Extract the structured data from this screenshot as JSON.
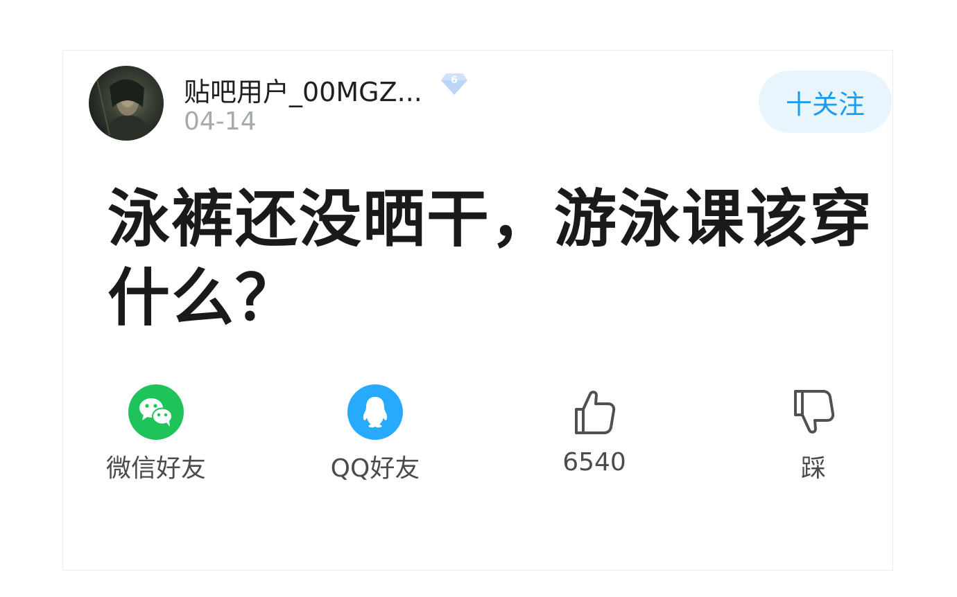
{
  "author": {
    "avatar_icon": "user-avatar",
    "name": "贴吧用户_00MGZ...",
    "level": "6",
    "level_badge_color": "#b9d6f6",
    "post_date": "04-14"
  },
  "follow_button": {
    "label": "十关注",
    "bg_color": "#e8f5fd",
    "text_color": "#1a9df0"
  },
  "post": {
    "title": "泳裤还没晒干，游泳课该穿什么？"
  },
  "actions": [
    {
      "id": "wechat",
      "label": "微信好友",
      "icon": "wechat-icon",
      "color": "#1ec45a"
    },
    {
      "id": "qq",
      "label": "QQ好友",
      "icon": "qq-icon",
      "color": "#27aafc"
    },
    {
      "id": "like",
      "label": "6540",
      "icon": "thumbs-up-icon"
    },
    {
      "id": "dislike",
      "label": "踩",
      "icon": "thumbs-down-icon"
    }
  ]
}
